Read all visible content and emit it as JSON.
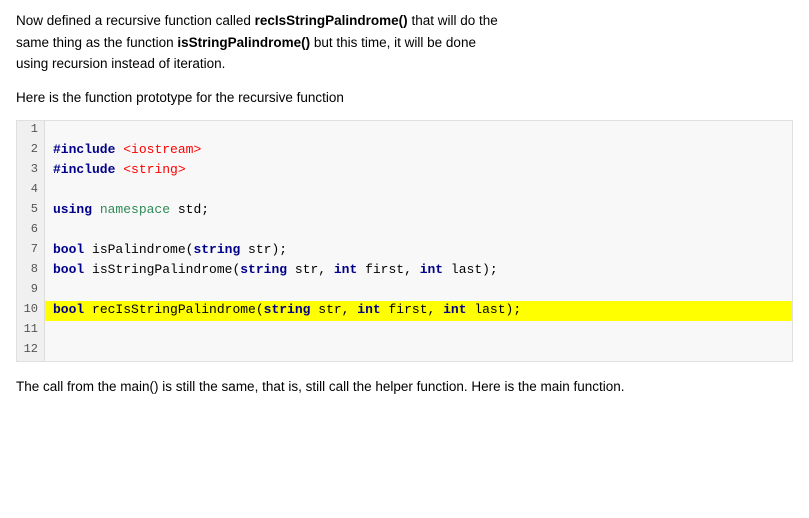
{
  "intro_paragraph": {
    "text_before": "Now defined a recursive function called ",
    "func1": "recIsStringPalindrome()",
    "text_middle": " that will do the same thing as the function ",
    "func2": "isStringPalindrome()",
    "text_after": " but this time, it will be done using recursion instead of iteration."
  },
  "proto_heading": "Here is the function prototype for the recursive function",
  "code_lines": [
    {
      "num": 1,
      "content": "",
      "highlighted": false
    },
    {
      "num": 2,
      "content": "#include <iostream>",
      "highlighted": false,
      "type": "include"
    },
    {
      "num": 3,
      "content": "#include <string>",
      "highlighted": false,
      "type": "include_string"
    },
    {
      "num": 4,
      "content": "",
      "highlighted": false
    },
    {
      "num": 5,
      "content": "using namespace std;",
      "highlighted": false,
      "type": "using"
    },
    {
      "num": 6,
      "content": "",
      "highlighted": false
    },
    {
      "num": 7,
      "content": "bool isPalindrome(string str);",
      "highlighted": false,
      "type": "proto"
    },
    {
      "num": 8,
      "content": "bool isStringPalindrome(string str, int first, int last);",
      "highlighted": false,
      "type": "proto"
    },
    {
      "num": 9,
      "content": "",
      "highlighted": false
    },
    {
      "num": 10,
      "content": "bool recIsStringPalindrome(string str, int first, int last);",
      "highlighted": true,
      "type": "proto_highlight"
    },
    {
      "num": 11,
      "content": "",
      "highlighted": false
    },
    {
      "num": 12,
      "content": "",
      "highlighted": false
    }
  ],
  "footer_paragraph": {
    "text": "The call from the main() is still the same, that is, still call the helper function. Here is the main function."
  }
}
